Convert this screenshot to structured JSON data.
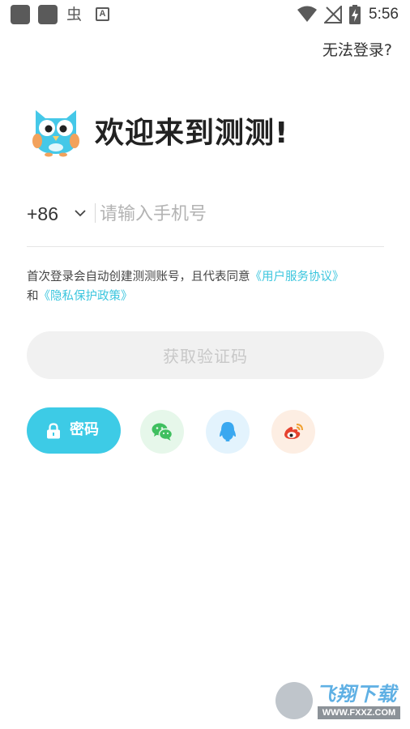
{
  "status_bar": {
    "time": "5:56",
    "icons": [
      "notification-square-icon",
      "notification-square-icon",
      "bug-icon",
      "font-a-icon",
      "wifi-icon",
      "no-signal-icon",
      "battery-charging-icon"
    ],
    "bug_glyph": "虫",
    "a_glyph": "A"
  },
  "header": {
    "cannot_login": "无法登录?"
  },
  "welcome": {
    "title": "欢迎来到测测!"
  },
  "phone": {
    "country_code": "+86",
    "placeholder": "请输入手机号",
    "value": ""
  },
  "agreement": {
    "prefix": "首次登录会自动创建测测账号，且代表同意",
    "user_agreement": "《用户服务协议》",
    "conjunction": "和",
    "privacy_policy": "《隐私保护政策》"
  },
  "buttons": {
    "get_code": "获取验证码",
    "password": "密码"
  },
  "social": [
    "wechat-icon",
    "qq-icon",
    "weibo-icon"
  ],
  "colors": {
    "accent": "#3dcbe6",
    "link": "#3cc6de",
    "disabled_bg": "#f1f1f1",
    "disabled_text": "#c8c8c8",
    "wechat_bg": "#e6f7ea",
    "qq_bg": "#e3f3fd",
    "weibo_bg": "#fdeee3"
  },
  "watermark": {
    "title": "飞翔下载",
    "url": "WWW.FXXZ.COM"
  }
}
